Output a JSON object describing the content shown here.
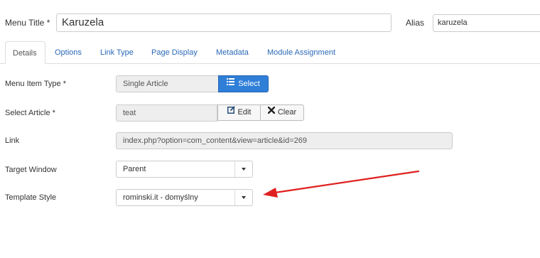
{
  "menu_title": {
    "label": "Menu Title *",
    "value": "Karuzela"
  },
  "alias": {
    "label": "Alias",
    "value": "karuzela"
  },
  "tabs": [
    {
      "label": "Details",
      "active": true
    },
    {
      "label": "Options"
    },
    {
      "label": "Link Type"
    },
    {
      "label": "Page Display"
    },
    {
      "label": "Metadata"
    },
    {
      "label": "Module Assignment"
    }
  ],
  "fields": {
    "menu_item_type": {
      "label": "Menu Item Type *",
      "value": "Single Article",
      "button": "Select"
    },
    "select_article": {
      "label": "Select Article *",
      "value": "teat",
      "edit_button": "Edit",
      "clear_button": "Clear"
    },
    "link": {
      "label": "Link",
      "value": "index.php?option=com_content&view=article&id=269"
    },
    "target_window": {
      "label": "Target Window",
      "value": "Parent"
    },
    "template_style": {
      "label": "Template Style",
      "value": "rominski.it - domyślny"
    }
  },
  "colors": {
    "primary_button": "#2f7ed8",
    "link": "#2a69b8",
    "annotation_arrow": "#e02020"
  },
  "icons": {
    "select": "list-icon",
    "edit": "edit-icon",
    "clear": "x-icon",
    "dropdown": "caret-down-icon"
  }
}
